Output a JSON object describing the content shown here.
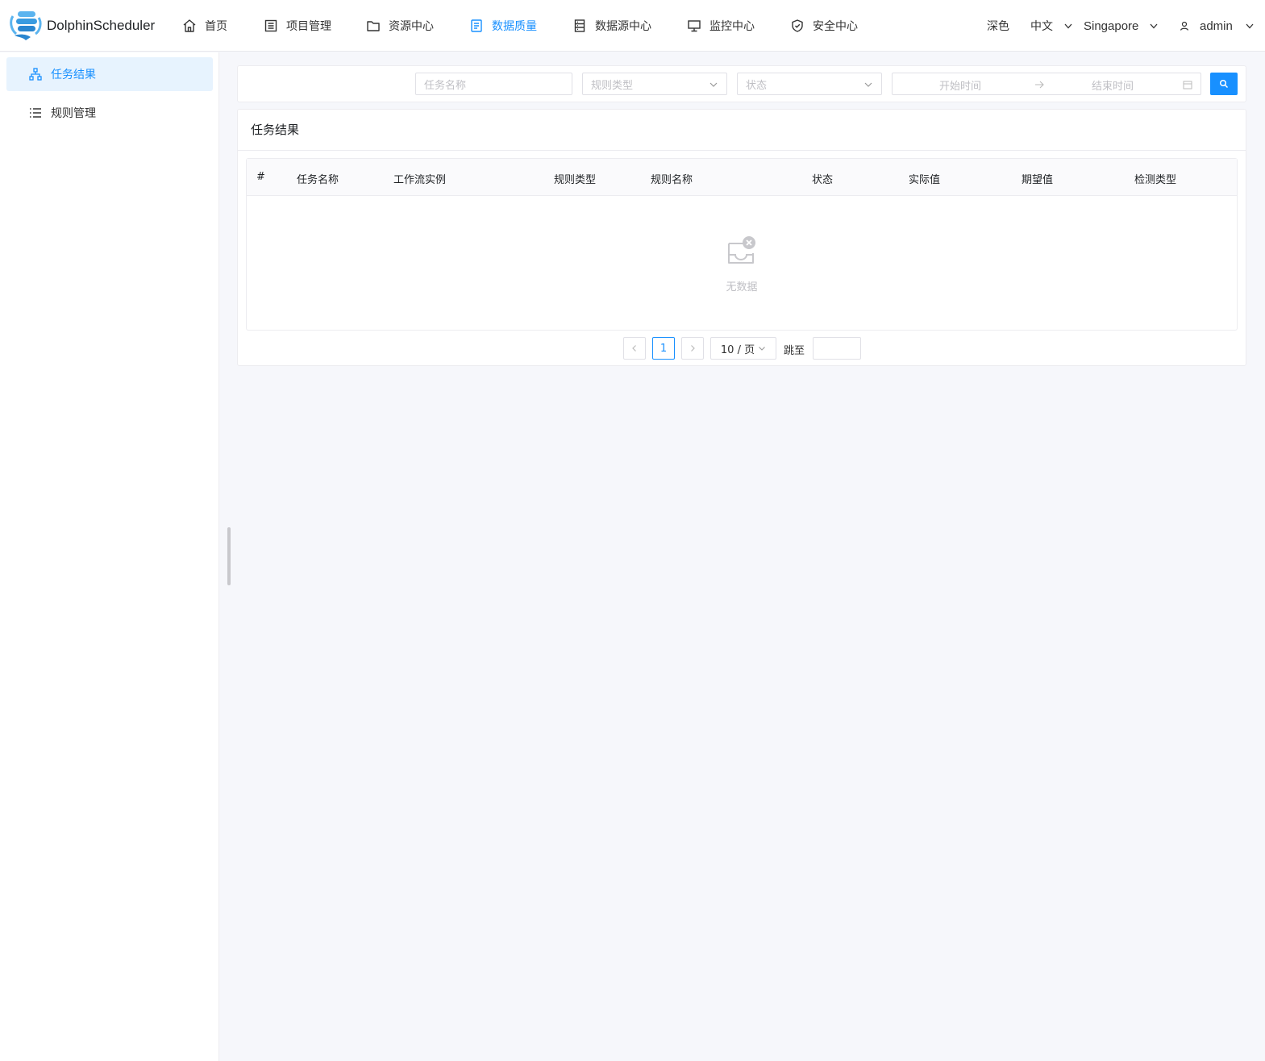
{
  "app": {
    "name": "DolphinScheduler"
  },
  "nav": [
    {
      "label": "首页",
      "icon": "home-icon"
    },
    {
      "label": "项目管理",
      "icon": "project-icon"
    },
    {
      "label": "资源中心",
      "icon": "folder-icon"
    },
    {
      "label": "数据质量",
      "icon": "data-quality-icon",
      "active": true
    },
    {
      "label": "数据源中心",
      "icon": "datasource-icon"
    },
    {
      "label": "监控中心",
      "icon": "monitor-icon"
    },
    {
      "label": "安全中心",
      "icon": "shield-icon"
    }
  ],
  "header_right": {
    "theme": "深色",
    "language": "中文",
    "timezone": "Singapore",
    "user": "admin"
  },
  "sidebar": {
    "items": [
      {
        "label": "任务结果",
        "icon": "task-result-icon",
        "active": true
      },
      {
        "label": "规则管理",
        "icon": "list-icon"
      }
    ]
  },
  "filter": {
    "task_name_placeholder": "任务名称",
    "rule_type_placeholder": "规则类型",
    "state_placeholder": "状态",
    "start_time_placeholder": "开始时间",
    "end_time_placeholder": "结束时间"
  },
  "card": {
    "title": "任务结果",
    "columns": [
      "#",
      "任务名称",
      "工作流实例",
      "规则类型",
      "规则名称",
      "状态",
      "实际值",
      "期望值",
      "检测类型"
    ],
    "empty_text": "无数据"
  },
  "pagination": {
    "current_page": "1",
    "page_size": "10 / 页",
    "jump_label": "跳至"
  },
  "colors": {
    "primary": "#1890ff",
    "background": "#f6f7fb",
    "active_bg": "#e7f3fe"
  }
}
